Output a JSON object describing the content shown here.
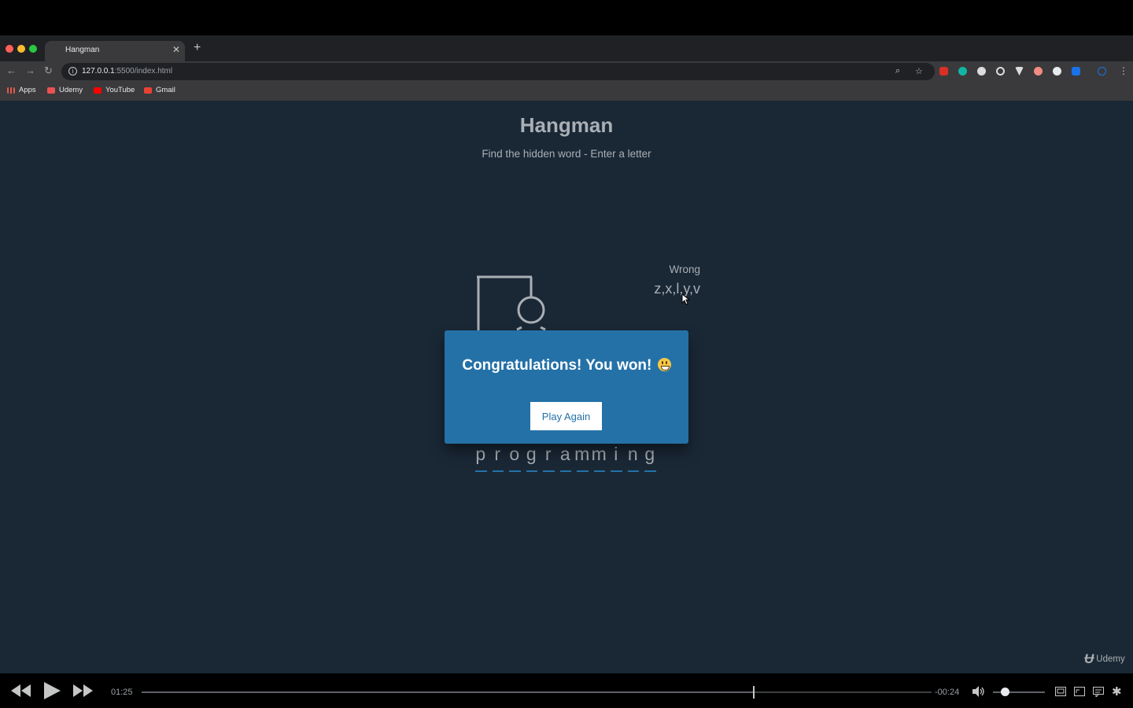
{
  "browser": {
    "tab_title": "Hangman",
    "tab_close": "✕",
    "new_tab": "+",
    "url_host": "127.0.0.1",
    "url_path": ":5500/index.html",
    "bookmarks": [
      {
        "label": "Apps",
        "icon": "apps-grid-icon",
        "color": "#e25a4f"
      },
      {
        "label": "Udemy",
        "icon": "udemy-icon",
        "color": "#ea5252"
      },
      {
        "label": "YouTube",
        "icon": "youtube-icon",
        "color": "#ff0000"
      },
      {
        "label": "Gmail",
        "icon": "gmail-icon",
        "color": "#ea4335"
      }
    ]
  },
  "game": {
    "title": "Hangman",
    "subtitle": "Find the hidden word - Enter a letter",
    "wrong_label": "Wrong",
    "wrong_letters": "z,x,l,y,v",
    "word_letters": [
      "p",
      "r",
      "o",
      "g",
      "r",
      "a",
      "m",
      "m",
      "i",
      "n",
      "g"
    ],
    "popup": {
      "message": "Congratulations! You won!",
      "emoji": "grinning-face-icon",
      "button_label": "Play Again"
    }
  },
  "watermark": {
    "logo": "Ʉ",
    "label": "Udemy"
  },
  "player": {
    "current_time": "01:25",
    "remaining_time": "-00:24",
    "progress_fraction": 0.775,
    "volume_fraction": 0.22
  },
  "colors": {
    "page_bg": "#1a2836",
    "accent": "#2471a8",
    "text_muted": "#a9afb5"
  }
}
